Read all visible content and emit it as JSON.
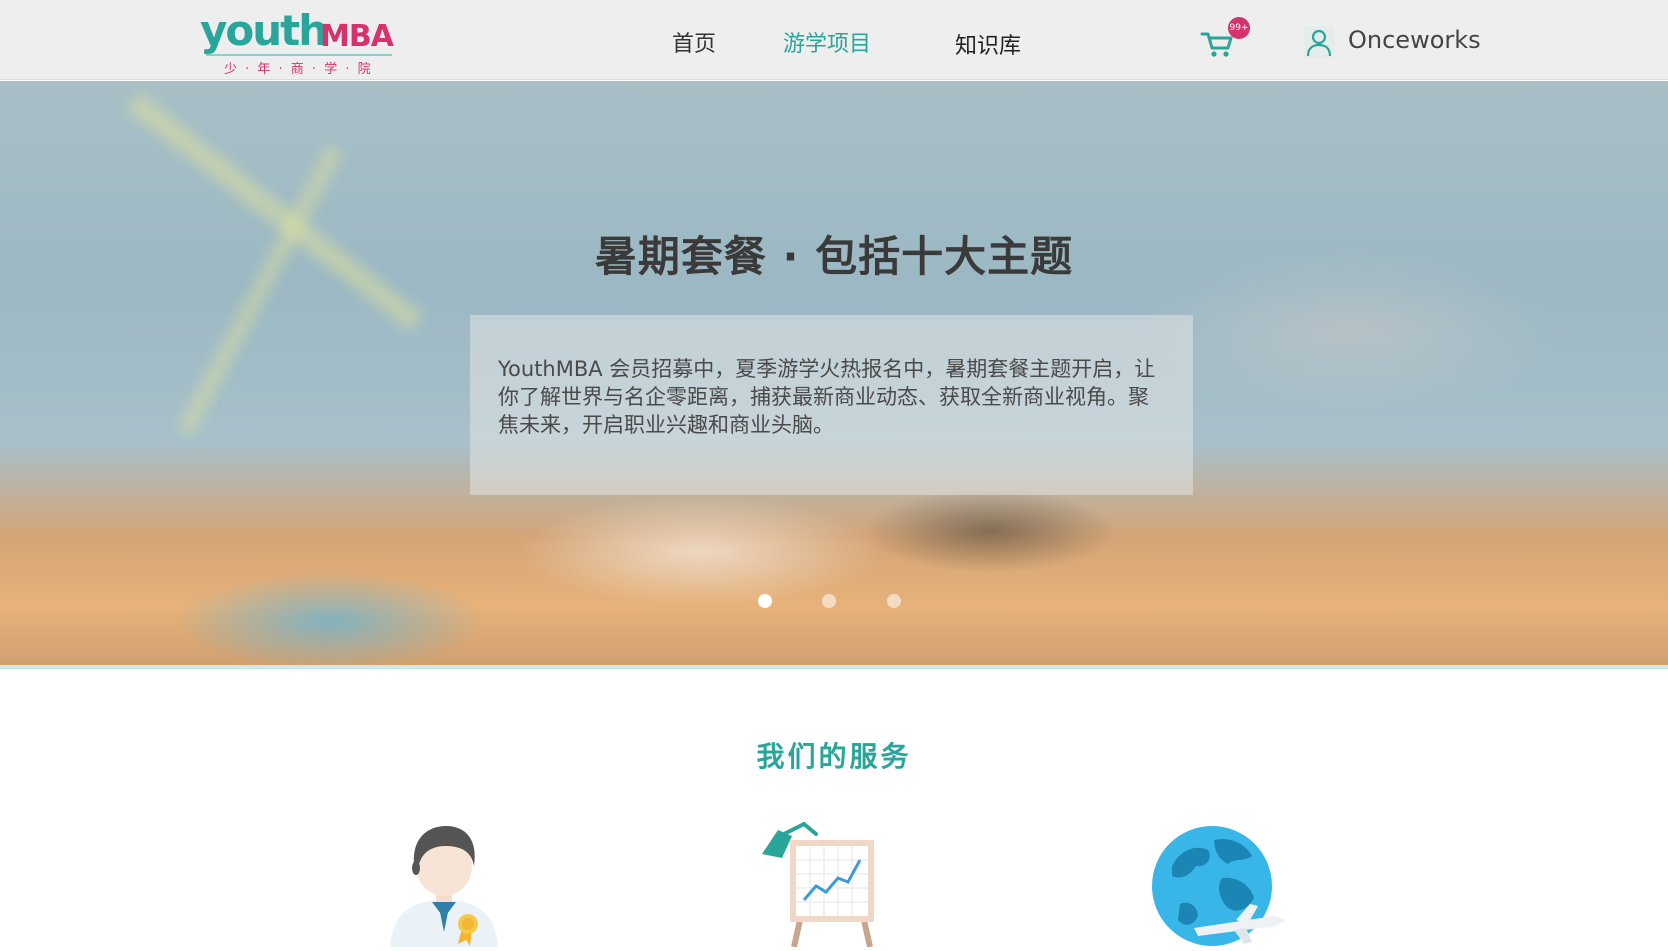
{
  "header": {
    "logo": {
      "main": "youth",
      "mba": "MBA",
      "sub": "少 · 年 · 商 · 学 · 院"
    },
    "nav": [
      {
        "label": "首页",
        "active": false
      },
      {
        "label": "游学项目",
        "active": true
      },
      {
        "label": "知识库",
        "active": false
      }
    ],
    "cart": {
      "icon": "cart-icon",
      "badge": "99+"
    },
    "user": {
      "icon": "user-icon",
      "name": "Onceworks"
    }
  },
  "hero": {
    "title": "暑期套餐 · 包括十大主题",
    "description": "YouthMBA 会员招募中，夏季游学火热报名中，暑期套餐主题开启，让你了解世界与名企零距离，捕获最新商业动态、获取全新商业视角。聚焦未来，开启职业兴趣和商业头脑。",
    "carousel": {
      "count": 3,
      "active_index": 0
    }
  },
  "services": {
    "title": "我们的服务",
    "items": [
      {
        "icon": "consultant-icon"
      },
      {
        "icon": "chart-board-icon"
      },
      {
        "icon": "globe-plane-icon"
      }
    ]
  },
  "colors": {
    "brand_teal": "#2aa59a",
    "brand_pink": "#d6336c",
    "header_bg": "#eeeeee"
  }
}
